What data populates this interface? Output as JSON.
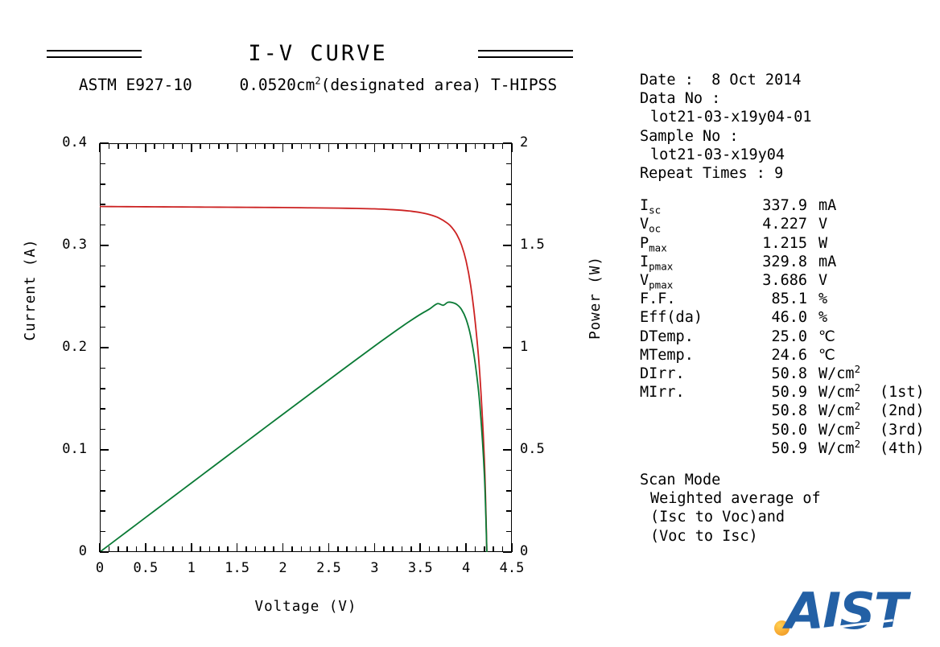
{
  "report": {
    "title": "I-V CURVE",
    "standard": "ASTM E927-10",
    "area_value": "0.0520cm",
    "area_exp": "2",
    "area_note": "(designated area)",
    "instrument": "T-HIPSS"
  },
  "meta": [
    {
      "label": "Date :",
      "value": "8 Oct 2014",
      "indent": false
    },
    {
      "label": "Data No :",
      "value": "",
      "indent": false
    },
    {
      "label": "lot21-03-x19y04-01",
      "value": "",
      "indent": true
    },
    {
      "label": "Sample No :",
      "value": "",
      "indent": false
    },
    {
      "label": "lot21-03-x19y04",
      "value": "",
      "indent": true
    },
    {
      "label": "Repeat Times : 9",
      "value": "",
      "indent": false
    }
  ],
  "parameters": [
    {
      "name": "I",
      "sub": "sc",
      "value": "337.9",
      "unit": "mA",
      "note": ""
    },
    {
      "name": "V",
      "sub": "oc",
      "value": "4.227",
      "unit": "V",
      "note": ""
    },
    {
      "name": "P",
      "sub": "max",
      "value": "1.215",
      "unit": "W",
      "note": ""
    },
    {
      "name": "I",
      "sub": "pmax",
      "value": "329.8",
      "unit": "mA",
      "note": ""
    },
    {
      "name": "V",
      "sub": "pmax",
      "value": "3.686",
      "unit": "V",
      "note": ""
    },
    {
      "name": "F.F.",
      "sub": "",
      "value": "85.1",
      "unit": "%",
      "note": ""
    },
    {
      "name": "Eff(da)",
      "sub": "",
      "value": "46.0",
      "unit": "%",
      "note": ""
    },
    {
      "name": "DTemp.",
      "sub": "",
      "value": "25.0",
      "unit": "℃",
      "note": ""
    },
    {
      "name": "MTemp.",
      "sub": "",
      "value": "24.6",
      "unit": "℃",
      "note": ""
    },
    {
      "name": "DIrr.",
      "sub": "",
      "value": "50.8",
      "unit": "W/cm",
      "unit_exp": "2",
      "note": ""
    },
    {
      "name": "MIrr.",
      "sub": "",
      "value": "50.9",
      "unit": "W/cm",
      "unit_exp": "2",
      "note": "(1st)"
    },
    {
      "name": "",
      "sub": "",
      "value": "50.8",
      "unit": "W/cm",
      "unit_exp": "2",
      "note": "(2nd)"
    },
    {
      "name": "",
      "sub": "",
      "value": "50.0",
      "unit": "W/cm",
      "unit_exp": "2",
      "note": "(3rd)"
    },
    {
      "name": "",
      "sub": "",
      "value": "50.9",
      "unit": "W/cm",
      "unit_exp": "2",
      "note": "(4th)"
    }
  ],
  "scan_mode": {
    "heading": "Scan Mode",
    "lines": [
      "Weighted average of",
      "(Isc to Voc)and",
      "(Voc to Isc)"
    ]
  },
  "logo": {
    "text": "AIST",
    "color": "#2360a5",
    "dot_color": "#f9ae36"
  },
  "chart_data": {
    "type": "line",
    "title": "I-V CURVE",
    "xlabel": "Voltage (V)",
    "ylabel": "Current (A)",
    "y2label": "Power (W)",
    "xlim": [
      0,
      4.5
    ],
    "ylim": [
      0,
      0.4
    ],
    "y2lim": [
      0,
      2
    ],
    "xticks": [
      "0",
      "0.5",
      "1",
      "1.5",
      "2",
      "2.5",
      "3",
      "3.5",
      "4",
      "4.5"
    ],
    "xtick_values": [
      0,
      0.5,
      1,
      1.5,
      2,
      2.5,
      3,
      3.5,
      4,
      4.5
    ],
    "yticks": [
      "0",
      "0.1",
      "0.2",
      "0.3",
      "0.4"
    ],
    "ytick_values": [
      0,
      0.1,
      0.2,
      0.3,
      0.4
    ],
    "y2ticks": [
      "0",
      "0.5",
      "1",
      "1.5",
      "2"
    ],
    "y2tick_values": [
      0,
      0.5,
      1,
      1.5,
      2
    ],
    "minor_ticks_per_major": 5,
    "grid": false,
    "legend": "none",
    "series": [
      {
        "name": "Current",
        "axis": "left",
        "color": "#cc2222",
        "x": [
          0.0,
          0.2,
          0.4,
          0.6,
          0.8,
          1.0,
          1.2,
          1.4,
          1.6,
          1.8,
          2.0,
          2.2,
          2.4,
          2.6,
          2.8,
          3.0,
          3.2,
          3.3,
          3.4,
          3.5,
          3.6,
          3.7,
          3.8,
          3.85,
          3.9,
          3.95,
          4.0,
          4.05,
          4.1,
          4.15,
          4.2,
          4.227
        ],
        "y": [
          0.3381,
          0.338,
          0.3379,
          0.3378,
          0.3377,
          0.3376,
          0.3375,
          0.3374,
          0.3373,
          0.3372,
          0.3371,
          0.3369,
          0.3367,
          0.3365,
          0.3362,
          0.3358,
          0.335,
          0.3344,
          0.3335,
          0.3322,
          0.3302,
          0.327,
          0.3215,
          0.317,
          0.3105,
          0.3005,
          0.285,
          0.261,
          0.225,
          0.174,
          0.09,
          0.0
        ]
      },
      {
        "name": "Power",
        "axis": "right",
        "color": "#0a7a35",
        "x": [
          0.0,
          0.2,
          0.4,
          0.6,
          0.8,
          1.0,
          1.2,
          1.4,
          1.6,
          1.8,
          2.0,
          2.2,
          2.4,
          2.6,
          2.8,
          3.0,
          3.2,
          3.3,
          3.4,
          3.5,
          3.6,
          3.686,
          3.75,
          3.8,
          3.85,
          3.9,
          3.95,
          4.0,
          4.05,
          4.1,
          4.15,
          4.2,
          4.227
        ],
        "y": [
          0.0,
          0.0676,
          0.1352,
          0.2027,
          0.2702,
          0.3376,
          0.405,
          0.4724,
          0.5397,
          0.607,
          0.6742,
          0.7412,
          0.8081,
          0.8749,
          0.9414,
          1.0074,
          1.072,
          1.1035,
          1.1339,
          1.1627,
          1.1887,
          1.215,
          1.2074,
          1.2217,
          1.2205,
          1.211,
          1.187,
          1.14,
          1.057,
          0.9225,
          0.7221,
          0.378,
          0.0
        ]
      }
    ],
    "markers": {
      "isc_a": 0.3379,
      "voc_v": 4.227,
      "pmax_w": 1.215,
      "vpmax_v": 3.686,
      "ipmax_a": 0.3298
    }
  }
}
